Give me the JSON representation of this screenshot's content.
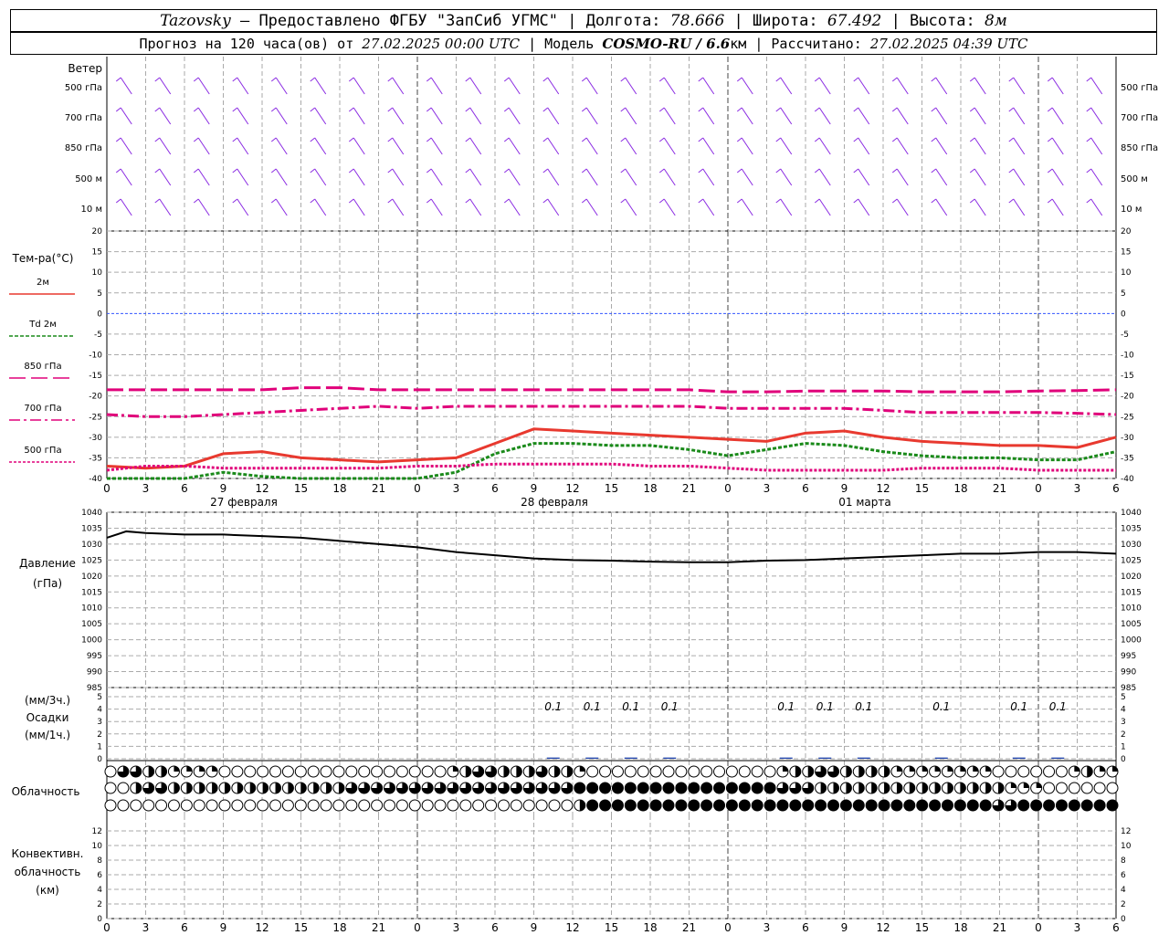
{
  "header": {
    "line1": {
      "station": "Tazovsky",
      "provider": " — Предоставлено ФГБУ \"ЗапСиб УГМС\" | Долгота: ",
      "lon": "78.666",
      "lat_label": " | Широта: ",
      "lat": "67.492",
      "alt_label": " | Высота: ",
      "alt": "8м"
    },
    "line2": {
      "fc_label": "Прогноз на 120 часа(ов) от ",
      "fc_time": "27.02.2025 00:00 UTC",
      "model_label": " | Модель ",
      "model": "COSMO-RU / 6.6",
      "model_unit": "км",
      "calc_label": " | Рассчитано: ",
      "calc_time": "27.02.2025 04:39 UTC"
    }
  },
  "chart_data": [
    {
      "type": "wind_barbs",
      "panel": "wind",
      "title": "Ветер",
      "levels": [
        "500 гПа",
        "700 гПа",
        "850 гПа",
        "500 м",
        "10 м"
      ],
      "color": "#8a2be2"
    },
    {
      "type": "line",
      "panel": "temperature",
      "ylabel": "Тем-ра(°C)",
      "ylim": [
        -40,
        20
      ],
      "yticks": [
        20,
        15,
        10,
        5,
        0,
        -5,
        -10,
        -15,
        -20,
        -25,
        -30,
        -35,
        -40
      ],
      "x_hours": [
        0,
        3,
        6,
        9,
        12,
        15,
        18,
        21,
        24,
        27,
        30,
        33,
        36,
        39,
        42,
        45,
        48,
        51,
        54,
        57,
        60,
        63,
        66,
        69,
        72,
        75,
        78
      ],
      "series": [
        {
          "name": "2м",
          "color": "#e8392f",
          "dash": "",
          "values": [
            -37,
            -37.5,
            -37,
            -34,
            -33.5,
            -35,
            -35.5,
            -36,
            -35.5,
            -35,
            -31.5,
            -28,
            -28.5,
            -29,
            -29.5,
            -30,
            -30.5,
            -31,
            -29,
            -28.5,
            -30,
            -31,
            -31.5,
            -32,
            -32,
            -32.5,
            -30
          ]
        },
        {
          "name": "Td 2м",
          "color": "#1a8a1a",
          "dash": "4,2",
          "values": [
            -45,
            -44,
            -42,
            -38.5,
            -39.5,
            -44,
            -44,
            -44,
            -40,
            -38.5,
            -34,
            -31.5,
            -31.5,
            -32,
            -32,
            -33,
            -34.5,
            -33,
            -31.5,
            -32,
            -33.5,
            -34.5,
            -35,
            -35,
            -35.5,
            -35.5,
            -33.5
          ]
        },
        {
          "name": "850 гПа",
          "color": "#e0007a",
          "dash": "18,6",
          "values": [
            -18.5,
            -18.5,
            -18.5,
            -18.5,
            -18.5,
            -18,
            -18,
            -18.5,
            -18.5,
            -18.5,
            -18.5,
            -18.5,
            -18.5,
            -18.5,
            -18.5,
            -18.5,
            -19,
            -19,
            -18.8,
            -18.8,
            -18.8,
            -19,
            -19,
            -19,
            -18.8,
            -18.7,
            -18.5
          ]
        },
        {
          "name": "700 гПа",
          "color": "#e0007a",
          "dash": "12,4,3,4",
          "values": [
            -24.5,
            -25,
            -25,
            -24.5,
            -24,
            -23.5,
            -23,
            -22.5,
            -23,
            -22.5,
            -22.5,
            -22.5,
            -22.5,
            -22.5,
            -22.5,
            -22.5,
            -23,
            -23,
            -23,
            -23,
            -23.5,
            -24,
            -24,
            -24,
            -24,
            -24.2,
            -24.5
          ]
        },
        {
          "name": "500 гПа",
          "color": "#e0007a",
          "dash": "3,2",
          "values": [
            -38,
            -37,
            -37,
            -37.5,
            -37.5,
            -37.5,
            -37.5,
            -37.5,
            -37,
            -37,
            -36.5,
            -36.5,
            -36.5,
            -36.5,
            -37,
            -37,
            -37.5,
            -38,
            -38,
            -38,
            -38,
            -37.5,
            -37.5,
            -37.5,
            -38,
            -38,
            -38
          ]
        }
      ]
    },
    {
      "type": "line",
      "panel": "pressure",
      "ylabel_1": "Давление",
      "ylabel_2": "(гПа)",
      "ylim": [
        985,
        1040
      ],
      "yticks": [
        1040,
        1035,
        1030,
        1025,
        1020,
        1015,
        1010,
        1005,
        1000,
        995,
        990,
        985
      ],
      "x_hours": [
        0,
        1.5,
        3,
        6,
        9,
        12,
        15,
        18,
        21,
        24,
        27,
        30,
        33,
        36,
        39,
        42,
        45,
        48,
        51,
        54,
        57,
        60,
        63,
        66,
        69,
        72,
        75,
        78
      ],
      "series": [
        {
          "name": "",
          "color": "#000000",
          "values": [
            1032,
            1034,
            1033.5,
            1033,
            1033,
            1032.5,
            1032,
            1031,
            1030,
            1029,
            1027.5,
            1026.5,
            1025.5,
            1025,
            1024.8,
            1024.5,
            1024.3,
            1024.3,
            1024.8,
            1025,
            1025.5,
            1026,
            1026.5,
            1027,
            1027,
            1027.5,
            1027.5,
            1027
          ]
        }
      ]
    },
    {
      "type": "bar",
      "panel": "precipitation",
      "ylabel_1": "(мм/3ч.)",
      "ylabel_2": "Осадки",
      "ylabel_3": "(мм/1ч.)",
      "ylim": [
        0,
        5
      ],
      "yticks": [
        5,
        4,
        3,
        2,
        1,
        0
      ],
      "annotations": [
        {
          "hour": 34.5,
          "label": "0.1"
        },
        {
          "hour": 37.5,
          "label": "0.1"
        },
        {
          "hour": 40.5,
          "label": "0.1"
        },
        {
          "hour": 43.5,
          "label": "0.1"
        },
        {
          "hour": 52.5,
          "label": "0.1"
        },
        {
          "hour": 55.5,
          "label": "0.1"
        },
        {
          "hour": 58.5,
          "label": "0.1"
        },
        {
          "hour": 64.5,
          "label": "0.1"
        },
        {
          "hour": 70.5,
          "label": "0.1"
        },
        {
          "hour": 73.5,
          "label": "0.1"
        }
      ]
    },
    {
      "type": "cloud_cover",
      "panel": "clouds",
      "ylabel": "Облачность",
      "rows": [
        "upper",
        "middle",
        "low"
      ],
      "hours_per_symbol": 1,
      "upper_fraction": [
        0,
        0.75,
        0.75,
        0.5,
        0.5,
        0.25,
        0.25,
        0.25,
        0.25,
        0,
        0,
        0,
        0,
        0,
        0,
        0,
        0,
        0,
        0,
        0,
        0,
        0,
        0,
        0,
        0,
        0,
        0,
        0.25,
        0.5,
        0.75,
        0.75,
        0.5,
        0.5,
        0.5,
        0.75,
        0.5,
        0.5,
        0.25,
        0,
        0,
        0,
        0,
        0,
        0,
        0,
        0,
        0,
        0,
        0,
        0,
        0,
        0,
        0,
        0.25,
        0.5,
        0.5,
        0.75,
        0.75,
        0.5,
        0.5,
        0.5,
        0.5,
        0.25,
        0.25,
        0.25,
        0.25,
        0.25,
        0.25,
        0.25,
        0.25,
        0,
        0,
        0,
        0,
        0,
        0,
        0.25,
        0.5,
        0.25,
        0.25
      ],
      "middle_fraction": [
        0,
        0,
        0.5,
        0.75,
        0.75,
        0.5,
        0.5,
        0.5,
        0.5,
        0.5,
        0.5,
        0.5,
        0.5,
        0.5,
        0.5,
        0.5,
        0.5,
        0.5,
        0.5,
        0.75,
        0.75,
        0.75,
        0.75,
        0.75,
        0.75,
        0.75,
        0.75,
        0.75,
        0.75,
        0.75,
        0.75,
        0.75,
        0.75,
        0.75,
        0.75,
        0.75,
        0.75,
        1,
        1,
        1,
        1,
        1,
        1,
        1,
        1,
        1,
        1,
        1,
        1,
        1,
        1,
        1,
        1,
        0.75,
        0.75,
        0.75,
        0.5,
        0.5,
        0.5,
        0.5,
        0.5,
        0.5,
        0.5,
        0.5,
        0.5,
        0.5,
        0.5,
        0.5,
        0.5,
        0.5,
        0.5,
        0.25,
        0.25,
        0.25,
        0,
        0,
        0,
        0,
        0,
        0
      ],
      "low_fraction": [
        0,
        0,
        0,
        0,
        0,
        0,
        0,
        0,
        0,
        0,
        0,
        0,
        0,
        0,
        0,
        0,
        0,
        0,
        0,
        0,
        0,
        0,
        0,
        0,
        0,
        0,
        0,
        0,
        0,
        0,
        0,
        0,
        0,
        0,
        0,
        0,
        0,
        0.5,
        1,
        1,
        1,
        1,
        1,
        1,
        1,
        1,
        1,
        1,
        1,
        1,
        1,
        1,
        1,
        1,
        1,
        1,
        1,
        1,
        1,
        1,
        1,
        1,
        1,
        1,
        1,
        1,
        1,
        1,
        1,
        1,
        0.75,
        0.75,
        1,
        1,
        1,
        1,
        1,
        1,
        1,
        1
      ]
    },
    {
      "type": "bar",
      "panel": "convective",
      "ylabel_1": "Конвективн.",
      "ylabel_2": "облачность",
      "ylabel_3": "(км)",
      "ylim": [
        0,
        13
      ],
      "yticks": [
        12,
        10,
        8,
        6,
        4,
        2,
        0
      ],
      "values": []
    }
  ],
  "x_axis": {
    "tick_labels": [
      "0",
      "3",
      "6",
      "9",
      "12",
      "15",
      "18",
      "21",
      "0",
      "3",
      "6",
      "9",
      "12",
      "15",
      "18",
      "21",
      "0",
      "3",
      "6",
      "9",
      "12",
      "15",
      "18",
      "21",
      "0",
      "3",
      "6"
    ],
    "day_labels": [
      "27 февраля",
      "28 февраля",
      "01 марта"
    ]
  }
}
